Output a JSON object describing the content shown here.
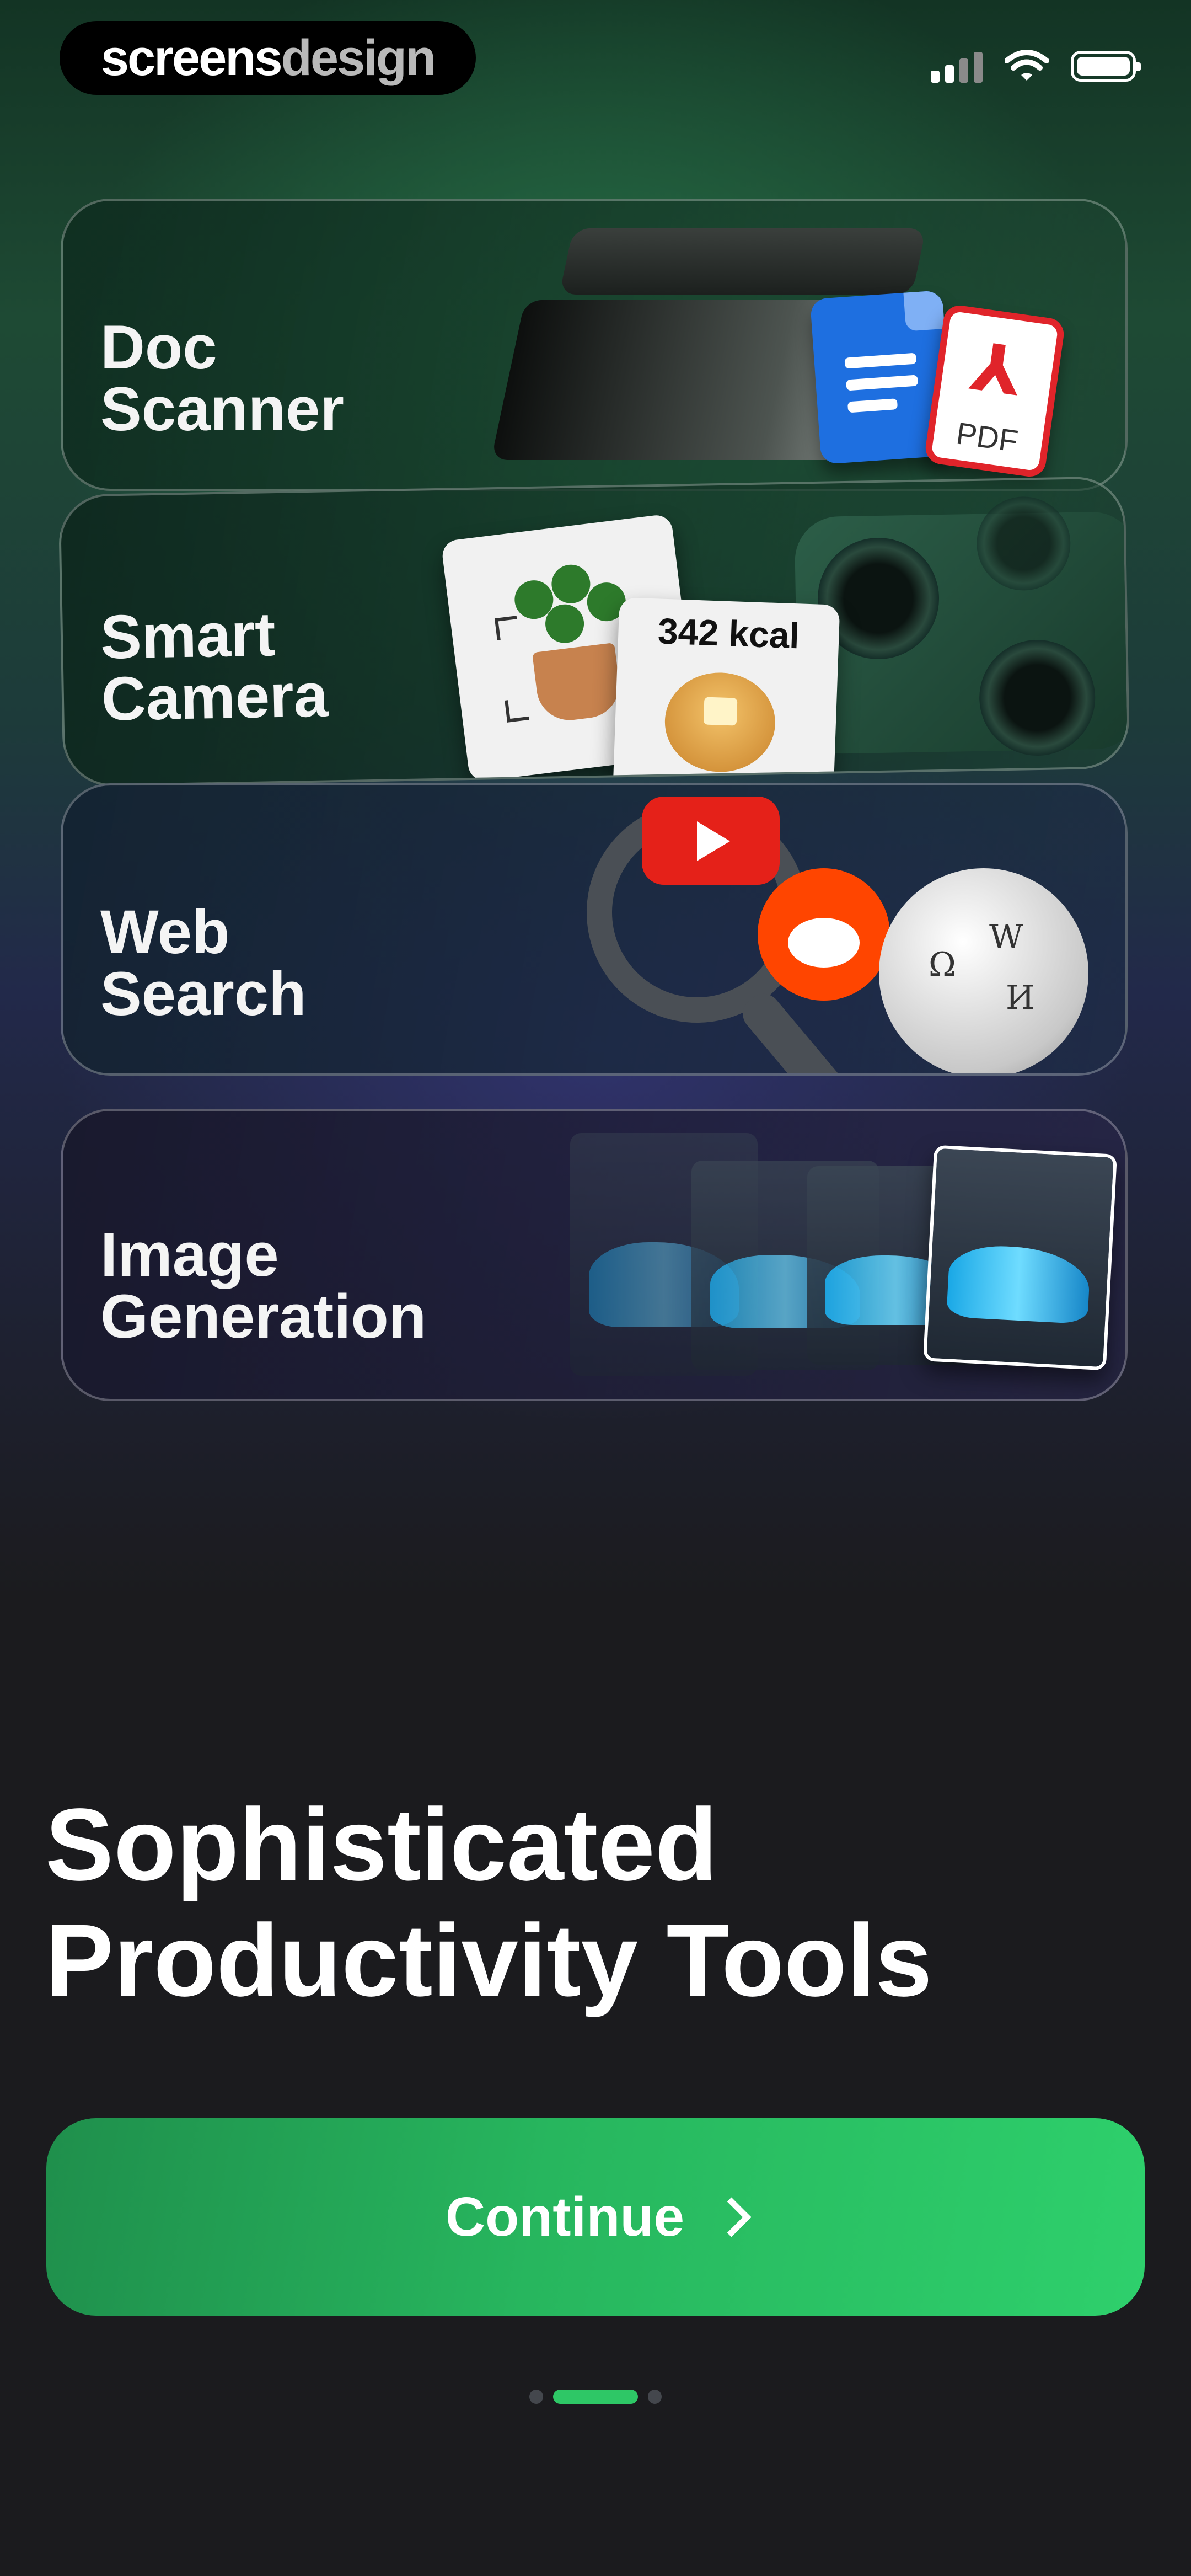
{
  "status_bar": {
    "brand_part1": "screens",
    "brand_part2": "design",
    "icons": [
      "cellular-signal-icon",
      "wifi-icon",
      "battery-icon"
    ]
  },
  "features": [
    {
      "line1": "Doc",
      "line2": "Scanner",
      "icons": [
        "scanner-image",
        "google-docs-icon",
        "pdf-icon"
      ],
      "pdf_label": "PDF"
    },
    {
      "line1": "Smart",
      "line2": "Camera",
      "icons": [
        "plant-photo",
        "pancake-photo",
        "phone-camera-image"
      ],
      "calorie_label": "342 kcal"
    },
    {
      "line1": "Web",
      "line2": "Search",
      "icons": [
        "magnifier-icon",
        "youtube-icon",
        "reddit-icon",
        "wikipedia-icon"
      ]
    },
    {
      "line1": "Image",
      "line2": "Generation",
      "icons": [
        "car-image-tiles"
      ]
    }
  ],
  "headline": {
    "line1": "Sophisticated",
    "line2": "Productivity Tools"
  },
  "cta": {
    "label": "Continue",
    "icon": "chevron-right-icon"
  },
  "pagination": {
    "total": 3,
    "active_index": 1
  },
  "colors": {
    "background": "#1b1b1e",
    "accent": "#2ec766",
    "pdf_red": "#e0242a",
    "docs_blue": "#1e6fe0"
  }
}
